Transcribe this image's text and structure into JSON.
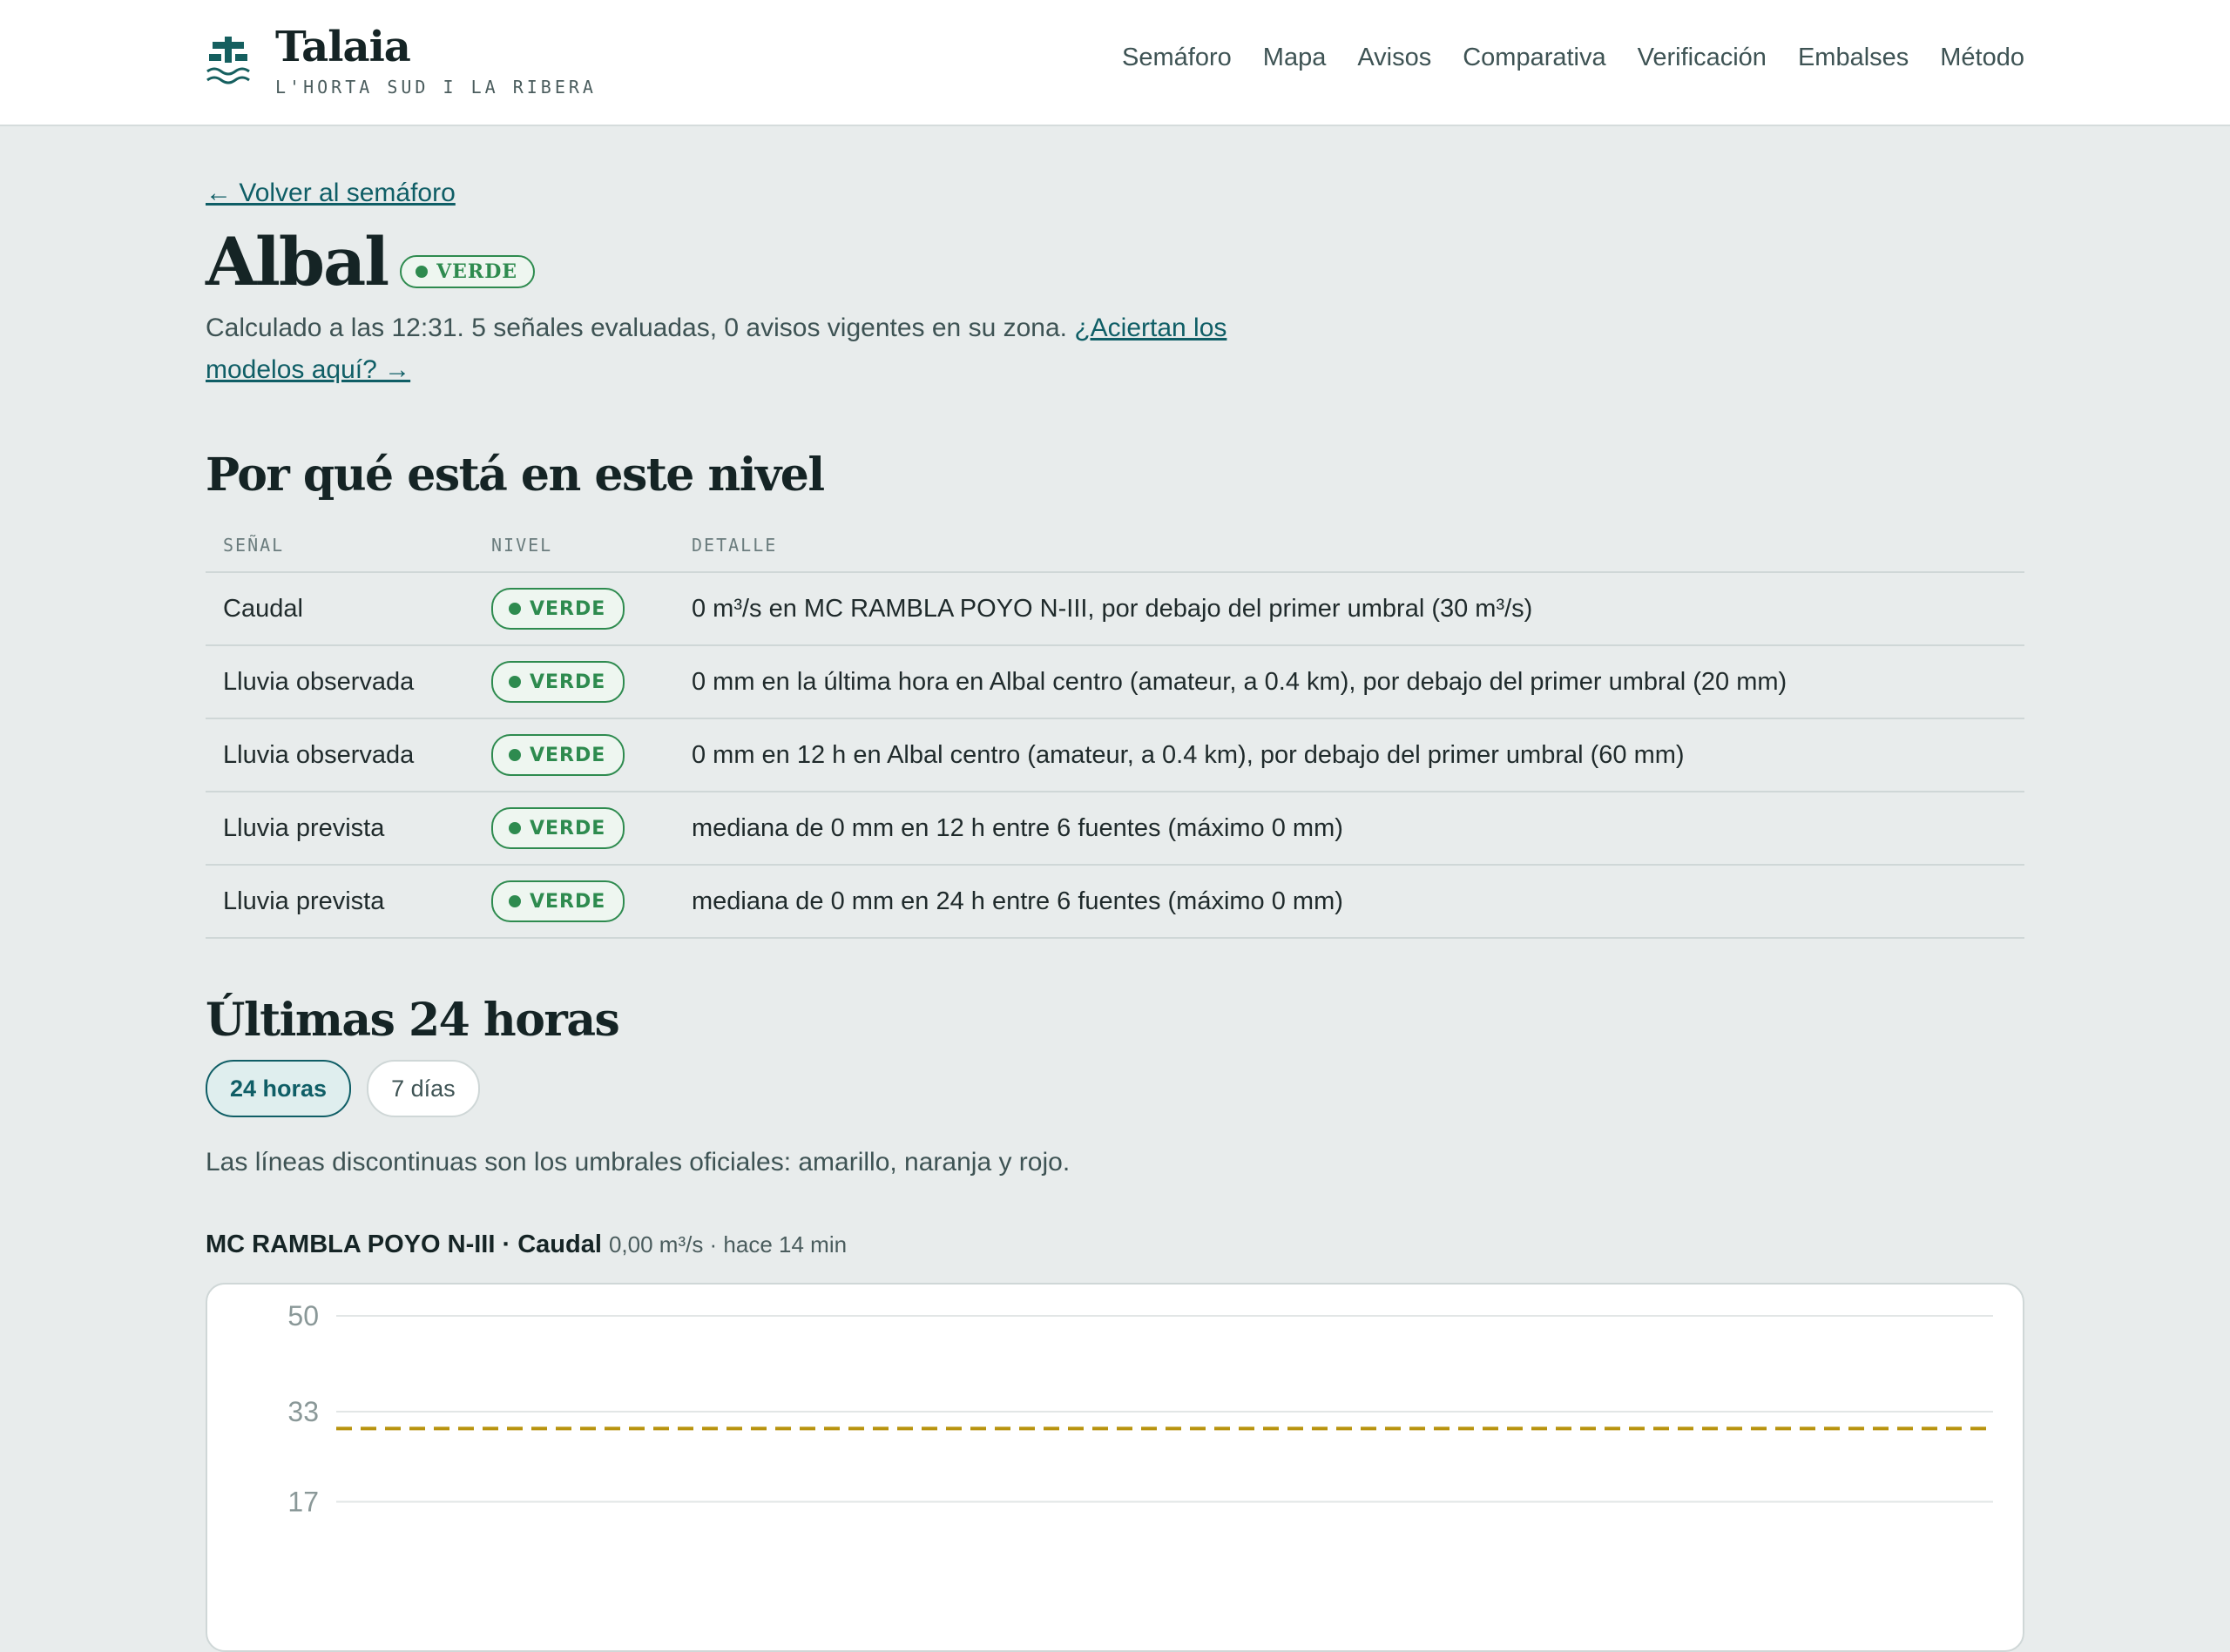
{
  "brand": {
    "name": "Talaia",
    "subtitle": "L'HORTA SUD I LA RIBERA",
    "logo_icon": "watchtower-waves-icon"
  },
  "nav": [
    "Semáforo",
    "Mapa",
    "Avisos",
    "Comparativa",
    "Verificación",
    "Embalses",
    "Método"
  ],
  "back_link": "← Volver al semáforo",
  "town": {
    "name": "Albal",
    "status": "VERDE",
    "status_color": "#2e8b4f"
  },
  "summary": {
    "text": "Calculado a las 12:31. 5 señales evaluadas, 0 avisos vigentes en su zona.",
    "link": "¿Aciertan los modelos aquí? →"
  },
  "why": {
    "heading": "Por qué está en este nivel",
    "columns": [
      "SEÑAL",
      "NIVEL",
      "DETALLE"
    ],
    "rows": [
      {
        "signal": "Caudal",
        "level": "VERDE",
        "detail": "0 m³/s en MC RAMBLA POYO N-III, por debajo del primer umbral (30 m³/s)"
      },
      {
        "signal": "Lluvia observada",
        "level": "VERDE",
        "detail": "0 mm en la última hora en Albal centro (amateur, a 0.4 km), por debajo del primer umbral (20 mm)"
      },
      {
        "signal": "Lluvia observada",
        "level": "VERDE",
        "detail": "0 mm en 12 h en Albal centro (amateur, a 0.4 km), por debajo del primer umbral (60 mm)"
      },
      {
        "signal": "Lluvia prevista",
        "level": "VERDE",
        "detail": "mediana de 0 mm en 12 h entre 6 fuentes (máximo 0 mm)"
      },
      {
        "signal": "Lluvia prevista",
        "level": "VERDE",
        "detail": "mediana de 0 mm en 24 h entre 6 fuentes (máximo 0 mm)"
      }
    ]
  },
  "last24": {
    "heading": "Últimas 24 horas",
    "tabs": [
      {
        "label": "24 horas",
        "active": true
      },
      {
        "label": "7 días",
        "active": false
      }
    ],
    "note": "Las líneas discontinuas son los umbrales oficiales: amarillo, naranja y rojo."
  },
  "chart": {
    "station": "MC RAMBLA POYO N-III",
    "variable": "· Caudal",
    "meta": "0,00 m³/s · hace 14 min",
    "threshold_color": "#b8930e"
  },
  "chart_data": {
    "type": "line",
    "title": "MC RAMBLA POYO N-III · Caudal",
    "xlabel": "",
    "ylabel": "",
    "yticks": [
      "50",
      "33",
      "17"
    ],
    "ylim": [
      0,
      50
    ],
    "thresholds": [
      {
        "name": "amarillo",
        "value": 30,
        "color": "#b8930e",
        "style": "dashed"
      }
    ],
    "grid": true
  }
}
